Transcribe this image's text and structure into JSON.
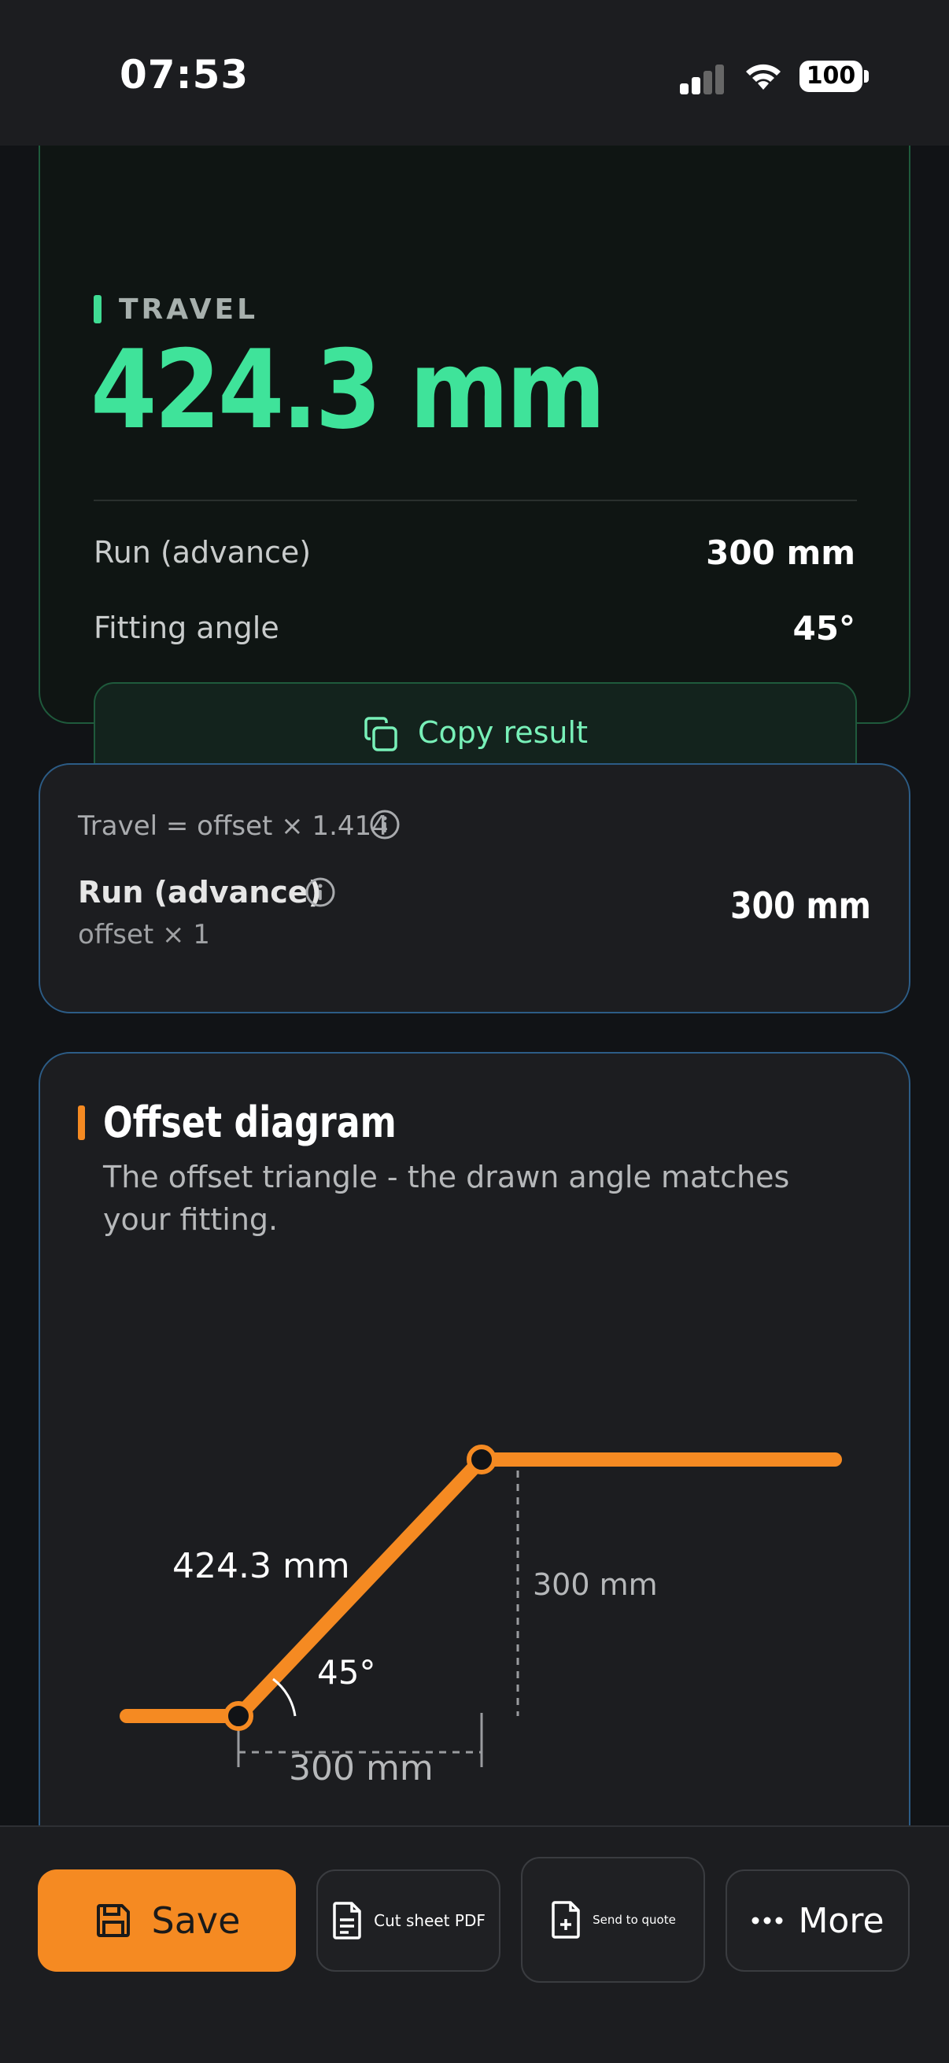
{
  "status_bar": {
    "time": "07:53",
    "battery": "100"
  },
  "result": {
    "label": "TRAVEL",
    "value": "424.3 mm",
    "rows": [
      {
        "label": "Run (advance)",
        "value": "300 mm"
      },
      {
        "label": "Fitting angle",
        "value": "45°"
      }
    ],
    "copy_label": "Copy result"
  },
  "formula": {
    "text": "Travel = offset × 1.414",
    "advance_label": "Run (advance)",
    "advance_sub": "offset × 1",
    "advance_value": "300 mm"
  },
  "diagram": {
    "title": "Offset diagram",
    "description": "The offset triangle - the drawn angle matches your fitting.",
    "travel_label": "424.3 mm",
    "angle_label": "45°",
    "offset_label": "300 mm",
    "run_label": "300 mm",
    "accent": "#f58a22"
  },
  "actions": {
    "save": "Save",
    "cut_sheet": "Cut sheet PDF",
    "quote": "Send to quote",
    "more": "More"
  },
  "colors": {
    "accent_green": "#3fe39a",
    "accent_orange": "#f58a22",
    "card_border_blue": "#2c5c86"
  }
}
